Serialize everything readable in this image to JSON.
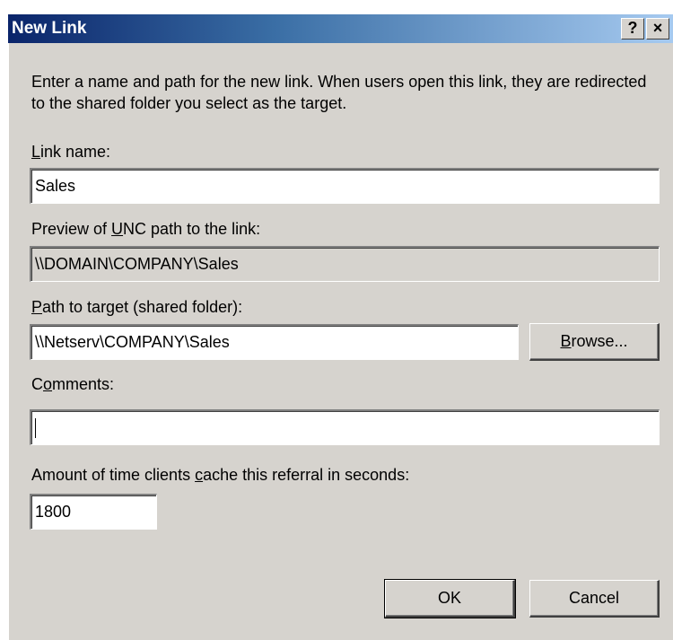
{
  "window": {
    "title": "New Link",
    "help_button": "?",
    "close_button": "×"
  },
  "description": "Enter a name and path for the new link. When users open this link, they are redirected to the shared folder you select as the target.",
  "link_name": {
    "label": "Link name:",
    "accesskey": "L",
    "value": "Sales"
  },
  "unc_preview": {
    "label": "Preview of UNC path to the link:",
    "accesskey": "U",
    "value": "\\\\DOMAIN\\COMPANY\\Sales"
  },
  "target_path": {
    "label": "Path to target (shared folder):",
    "accesskey": "P",
    "value": "\\\\Netserv\\COMPANY\\Sales"
  },
  "browse_button": "Browse...",
  "comments": {
    "label": "Comments:",
    "accesskey": "o",
    "value": ""
  },
  "cache": {
    "label": "Amount of time clients cache this referral in seconds:",
    "accesskey": "c",
    "value": "1800"
  },
  "ok_button": "OK",
  "cancel_button": "Cancel"
}
